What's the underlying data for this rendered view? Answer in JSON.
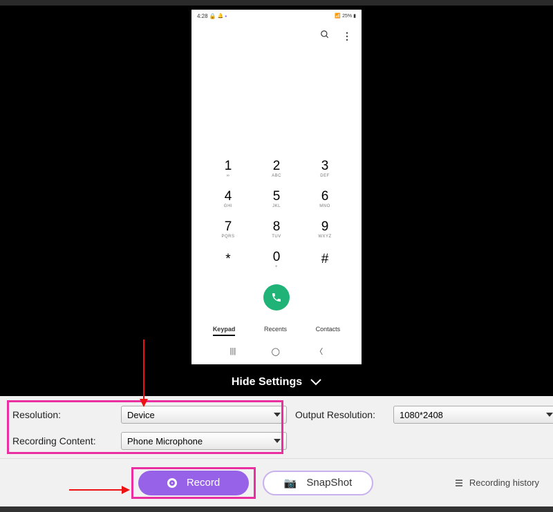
{
  "status": {
    "time": "4:28",
    "battery": "25%"
  },
  "phone": {
    "keys": [
      {
        "num": "1",
        "letters": "∞"
      },
      {
        "num": "2",
        "letters": "ABC"
      },
      {
        "num": "3",
        "letters": "DEF"
      },
      {
        "num": "4",
        "letters": "GHI"
      },
      {
        "num": "5",
        "letters": "JKL"
      },
      {
        "num": "6",
        "letters": "MNO"
      },
      {
        "num": "7",
        "letters": "PQRS"
      },
      {
        "num": "8",
        "letters": "TUV"
      },
      {
        "num": "9",
        "letters": "WXYZ"
      },
      {
        "num": "*",
        "letters": ""
      },
      {
        "num": "0",
        "letters": "+"
      },
      {
        "num": "#",
        "letters": ""
      }
    ],
    "tabs": {
      "keypad": "Keypad",
      "recents": "Recents",
      "contacts": "Contacts"
    }
  },
  "hide_settings": "Hide Settings",
  "settings": {
    "resolution_label": "Resolution:",
    "resolution_value": "Device",
    "recording_content_label": "Recording Content:",
    "recording_content_value": "Phone Microphone",
    "output_resolution_label": "Output Resolution:",
    "output_resolution_value": "1080*2408"
  },
  "buttons": {
    "record": "Record",
    "snapshot": "SnapShot",
    "history": "Recording history"
  }
}
